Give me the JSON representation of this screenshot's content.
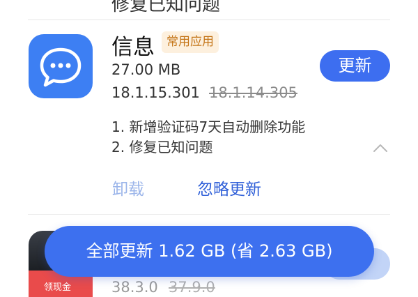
{
  "previous_item": {
    "notes_peek": "修复已知问题"
  },
  "app": {
    "name": "信息",
    "tag": "常用应用",
    "size": "27.00 MB",
    "new_version": "18.1.15.301",
    "old_version": "18.1.14.305",
    "update_label": "更新",
    "release_notes": [
      "1. 新增验证码7天自动删除功能",
      "2. 修复已知问题"
    ],
    "uninstall_label": "卸载",
    "ignore_label": "忽略更新",
    "icon": "message-bubble-icon",
    "accent_color": "#3d7ff3"
  },
  "next_app": {
    "badge": "领现金",
    "new_version": "38.3.0",
    "old_version": "37.9.0"
  },
  "update_all_label": "全部更新 1.62 GB (省 2.63 GB)",
  "colors": {
    "primary": "#3d6ef0",
    "tag_text": "#c47416",
    "tag_bg": "#fdf0de",
    "link": "#2f5fd8",
    "link_disabled": "#9bb5ea"
  }
}
